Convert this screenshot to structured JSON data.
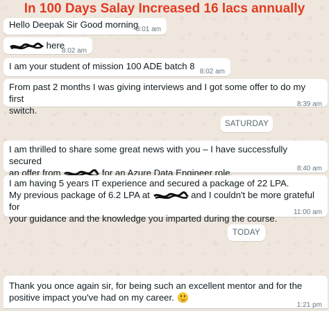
{
  "banner": {
    "title": "In 100 Days Salay Increased 16 lacs annually"
  },
  "messages": [
    {
      "text": "Hello Deepak Sir Good morning",
      "time": "8:01 am"
    },
    {
      "text": "here",
      "time": "8:02 am"
    },
    {
      "text": "I am your student of mission 100 ADE batch 8",
      "time": "8:02 am"
    },
    {
      "line1": "From past 2 months I was giving interviews and I got some offer to do my first",
      "line2": "switch.",
      "time": "8:39 am"
    },
    {
      "line1": "I am thrilled to share some great news with you – I have successfully secured",
      "line2_pre": "an offer from",
      "line2_post": "for an Azure Data Engineer role.",
      "time": "8:40 am"
    },
    {
      "line1": "I am having 5 years IT experience and secured a package of 22 LPA.",
      "line2_pre": "My previous package of 6.2 LPA at",
      "line2_post": "and I couldn't be more grateful for",
      "line3": "your guidance and the knowledge you imparted during the course.",
      "time": "11:00 am"
    },
    {
      "line1": "Thank you once again sir, for being such an excellent mentor and for the",
      "line2": "positive impact you've had on my career.",
      "emoji": "smiling-face-emoji",
      "time": "1:21 pm"
    }
  ],
  "dates": {
    "saturday": "SATURDAY",
    "today": "TODAY"
  },
  "colors": {
    "banner": "#e23a21",
    "bubble": "#ffffff",
    "background": "#efe7de",
    "timestamp": "#667781"
  }
}
